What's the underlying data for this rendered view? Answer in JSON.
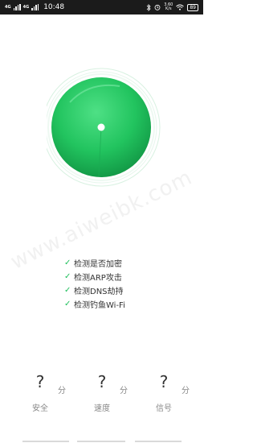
{
  "status_bar": {
    "network_1": "4G",
    "network_2": "4G",
    "time": "10:48",
    "speed_value": "3.60",
    "speed_unit": "K/s",
    "battery": "89"
  },
  "watermark": "www.aiweibk.com",
  "checks": [
    {
      "label": "检测是否加密"
    },
    {
      "label": "检测ARP攻击"
    },
    {
      "label": "检测DNS劫持"
    },
    {
      "label": "检测钓鱼Wi-Fi"
    }
  ],
  "scores": [
    {
      "value": "?",
      "unit": "分",
      "label": "安全"
    },
    {
      "value": "?",
      "unit": "分",
      "label": "速度"
    },
    {
      "value": "?",
      "unit": "分",
      "label": "信号"
    }
  ],
  "colors": {
    "accent_green": "#1fbf5c",
    "status_bar_bg": "#1b1b1b"
  },
  "icons": [
    "bluetooth-icon",
    "alarm-icon",
    "wifi-icon",
    "battery-icon",
    "check-icon"
  ]
}
